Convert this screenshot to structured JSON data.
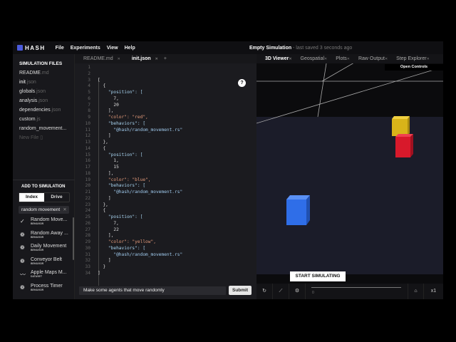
{
  "topbar": {
    "logo": "HASH",
    "menu": [
      "File",
      "Experiments",
      "View",
      "Help"
    ],
    "title": "Empty Simulation",
    "saved": "- last saved 3 seconds ago"
  },
  "sidebar": {
    "heading": "SIMULATION FILES",
    "files": [
      {
        "name": "README",
        "ext": ".md"
      },
      {
        "name": "init",
        "ext": ".json"
      },
      {
        "name": "globals",
        "ext": ".json"
      },
      {
        "name": "analysis",
        "ext": ".json"
      },
      {
        "name": "dependencies",
        "ext": ".json"
      },
      {
        "name": "custom",
        "ext": ".js"
      },
      {
        "name": "random_movement...",
        "ext": ""
      }
    ],
    "new_file": "New File"
  },
  "add": {
    "heading": "ADD TO SIMULATION",
    "tabs": [
      "Index",
      "Drive"
    ],
    "search": "random movement",
    "items": [
      {
        "name": "Random Move...",
        "type": "BEHAVIOR",
        "icon": "check"
      },
      {
        "name": "Random Away ...",
        "type": "BEHAVIOR",
        "icon": "brain"
      },
      {
        "name": "Daily Movement",
        "type": "BEHAVIOR",
        "icon": "brain"
      },
      {
        "name": "Conveyor Belt",
        "type": "BEHAVIOR",
        "icon": "brain"
      },
      {
        "name": "Apple Maps M...",
        "type": "DATASET",
        "icon": "chart"
      },
      {
        "name": "Process Timer",
        "type": "BEHAVIOR",
        "icon": "brain"
      }
    ]
  },
  "editor": {
    "tabs": [
      "README.md",
      "init.json"
    ],
    "add": "+",
    "lines": [
      "",
      "",
      "[",
      "  {",
      "    \"position\": [",
      "      7,",
      "      20",
      "    ],",
      "    \"color\": \"red\",",
      "    \"behaviors\": [",
      "      \"@hash/random_movement.rs\"",
      "    ]",
      "  },",
      "  {",
      "    \"position\": [",
      "      1,",
      "      15",
      "    ],",
      "    \"color\": \"blue\",",
      "    \"behaviors\": [",
      "      \"@hash/random_movement.rs\"",
      "    ]",
      "  },",
      "  {",
      "    \"position\": [",
      "      7,",
      "      22",
      "    ],",
      "    \"color\": \"yellow\",",
      "    \"behaviors\": [",
      "      \"@hash/random_movement.rs\"",
      "    ]",
      "  }",
      "]"
    ],
    "help": "?",
    "prompt": "Make some agents that move randomly",
    "submit": "Submit"
  },
  "viewer": {
    "tabs": [
      "3D Viewer",
      "Geospatial",
      "Plots",
      "Raw Output",
      "Step Explorer"
    ],
    "open_controls": "Open Controls",
    "start": "START SIMULATING",
    "step": "0",
    "speed": "x1"
  },
  "colors": {
    "red": "#e0192b",
    "blue": "#2f6ee8",
    "yellow": "#e5c21a",
    "ground": "#1b1c29"
  }
}
